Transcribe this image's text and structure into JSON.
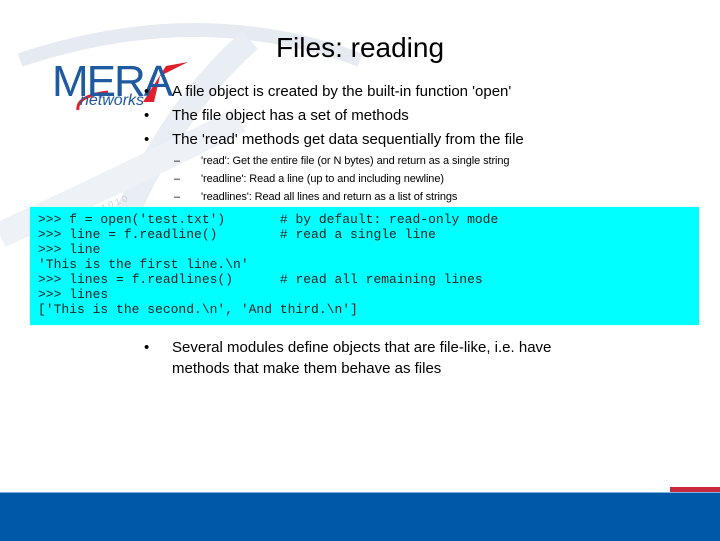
{
  "slide": {
    "title": "Files: reading",
    "logo": {
      "brand": "MERA",
      "tagline": "networks"
    },
    "bullets": [
      {
        "text": "A file object is created by the built-in function 'open'"
      },
      {
        "text": "The file object has a set of methods"
      },
      {
        "text": "The 'read' methods get data sequentially from the file",
        "subitems": [
          "'read': Get the entire file (or N bytes) and return as a single string",
          "'readline': Read a line (up to and including newline)",
          "'readlines': Read all lines and return as a list of strings"
        ]
      }
    ],
    "code_lines": [
      ">>> f = open('test.txt')       # by default: read-only mode",
      ">>> line = f.readline()        # read a single line",
      ">>> line",
      "'This is the first line.\\n'",
      ">>> lines = f.readlines()      # read all remaining lines",
      ">>> lines",
      "['This is the second.\\n', 'And third.\\n']"
    ],
    "bullets_after": [
      {
        "text": "Several modules define objects that are file-like, i.e. have methods that make them behave as files"
      }
    ],
    "bullet_mark": "•",
    "sub_mark": "–",
    "colors": {
      "code_background": "#00ffff",
      "footer": "#0058a8",
      "accent": "#c8283c",
      "logo_blue": "#1f5aa0",
      "logo_red": "#e0202a"
    }
  }
}
